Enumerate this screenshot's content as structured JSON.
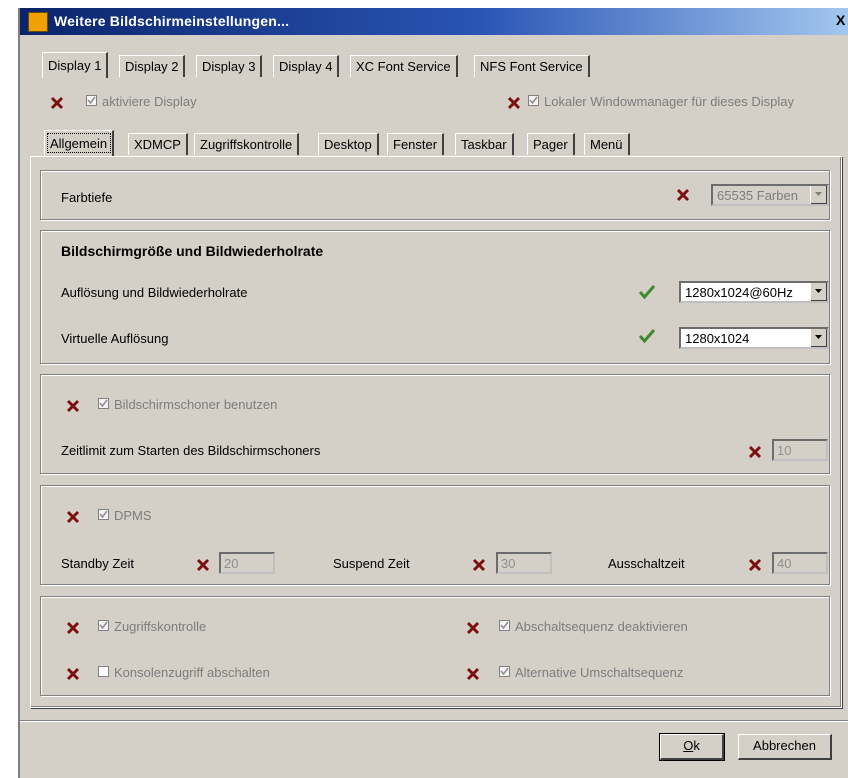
{
  "window": {
    "title": "Weitere Bildschirmeinstellungen...",
    "close_glyph": "X"
  },
  "display_tabs": [
    "Display 1",
    "Display 2",
    "Display 3",
    "Display 4",
    "XC Font Service",
    "NFS Font Service"
  ],
  "display_options": {
    "activate_display": "aktiviere Display",
    "local_wm": "Lokaler Windowmanager für dieses Display"
  },
  "sub_tabs": [
    "Allgemein",
    "XDMCP",
    "Zugriffskontrolle",
    "Desktop",
    "Fenster",
    "Taskbar",
    "Pager",
    "Menü"
  ],
  "color_depth": {
    "label": "Farbtiefe",
    "value": "65535 Farben"
  },
  "screen": {
    "heading": "Bildschirmgröße und Bildwiederholrate",
    "resolution_label": "Auflösung und Bildwiederholrate",
    "resolution_value": "1280x1024@60Hz",
    "virtual_label": "Virtuelle Auflösung",
    "virtual_value": "1280x1024"
  },
  "screensaver": {
    "use_label": "Bildschirmschoner benutzen",
    "timeout_label": "Zeitlimit zum Starten des Bildschirmschoners",
    "timeout_value": "10"
  },
  "dpms": {
    "label": "DPMS",
    "standby_label": "Standby Zeit",
    "standby_value": "20",
    "suspend_label": "Suspend Zeit",
    "suspend_value": "30",
    "off_label": "Ausschaltzeit",
    "off_value": "40"
  },
  "misc": {
    "access_control": "Zugriffskontrolle",
    "disable_shutdown": "Abschaltsequenz deaktivieren",
    "disable_console": "Konsolenzugriff abschalten",
    "alt_switch": "Alternative Umschaltsequenz"
  },
  "buttons": {
    "ok": "Ok",
    "cancel": "Abbrechen"
  },
  "colors": {
    "x_mark": "#7a1010",
    "check_mark": "#3c8a2c",
    "title_start": "#0a246a",
    "title_end": "#a6caf0"
  }
}
